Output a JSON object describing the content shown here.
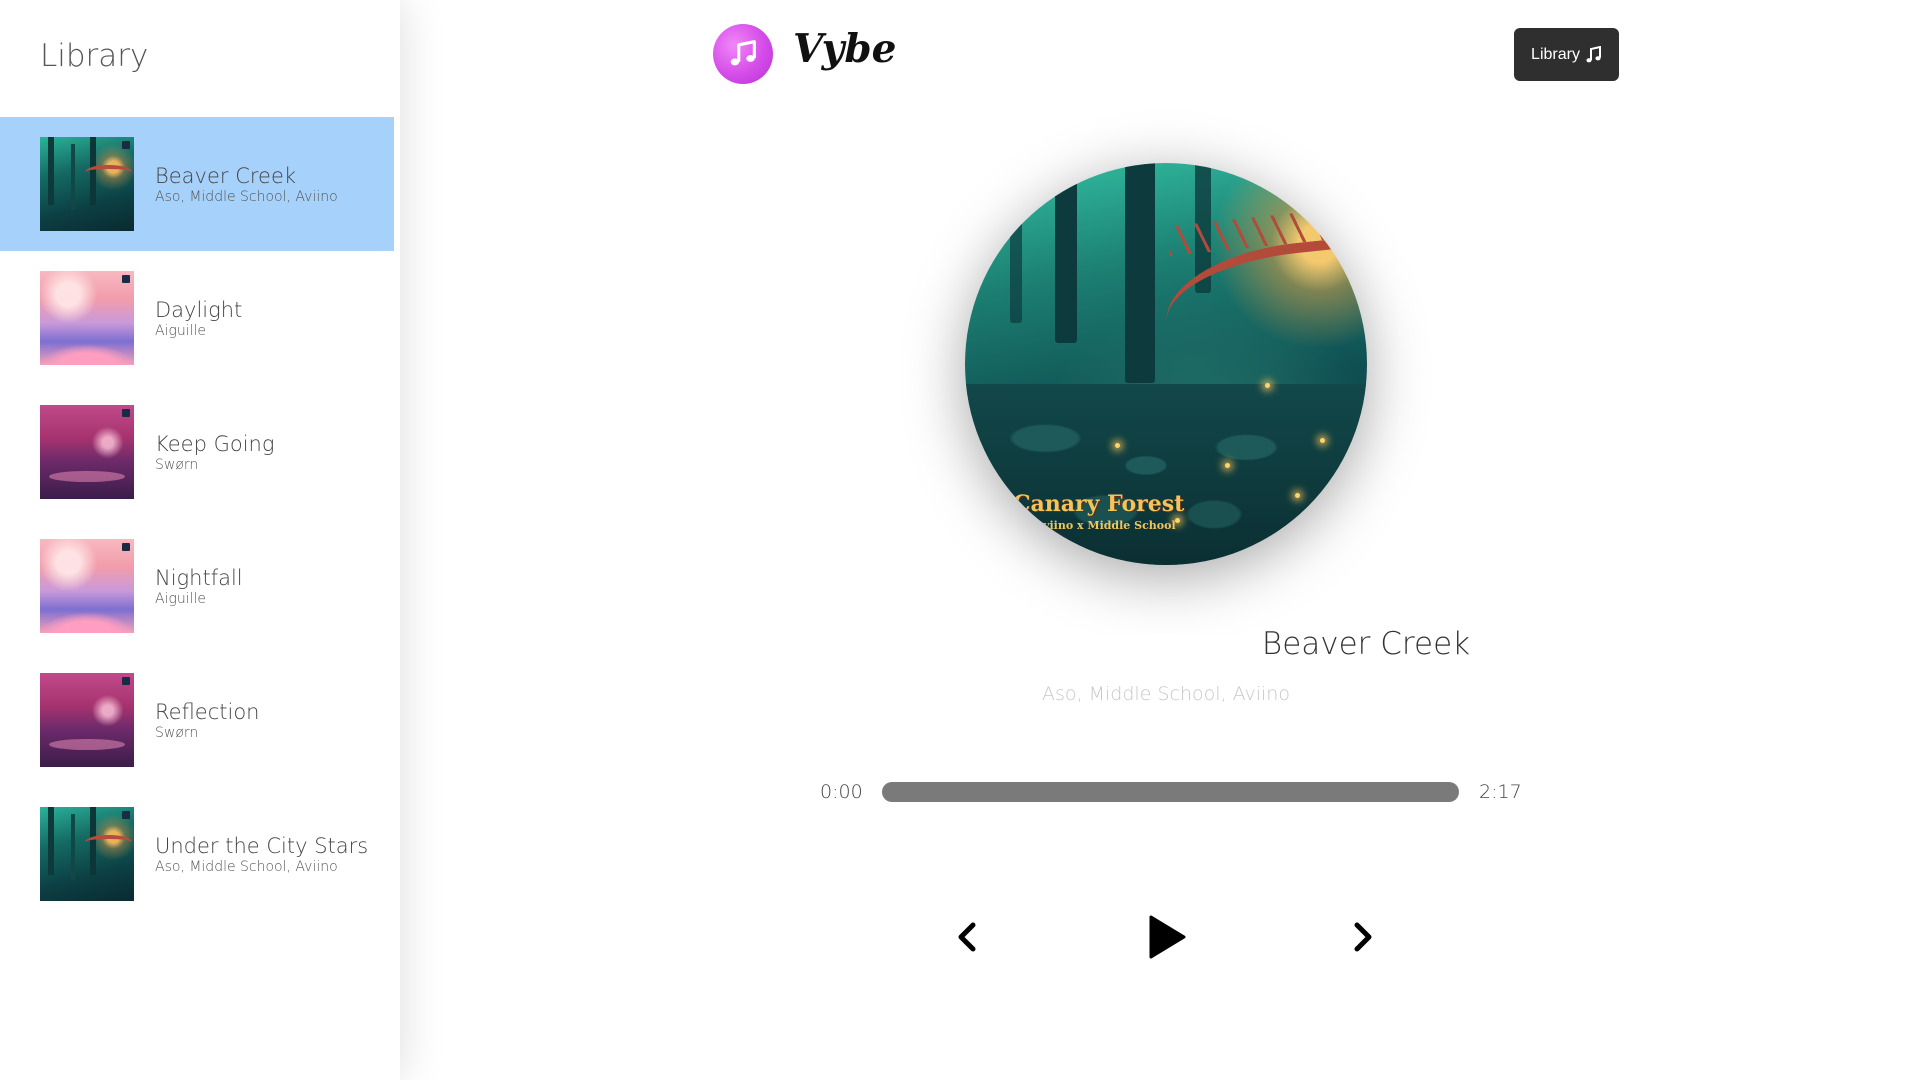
{
  "app": {
    "name": "Vybe",
    "library_button_label": "Library",
    "accent_color": "#a6d1fb",
    "logo_color": "#d44ce8"
  },
  "sidebar": {
    "title": "Library",
    "songs": [
      {
        "name": "Beaver Creek",
        "artist": "Aso, Middle School, Aviino",
        "cover": "forest",
        "active": true
      },
      {
        "name": "Daylight",
        "artist": "Aiguille",
        "cover": "pink",
        "active": false
      },
      {
        "name": "Keep Going",
        "artist": "Swørn",
        "cover": "magenta",
        "active": false
      },
      {
        "name": "Nightfall",
        "artist": "Aiguille",
        "cover": "pink",
        "active": false
      },
      {
        "name": "Reflection",
        "artist": "Swørn",
        "cover": "magenta",
        "active": false
      },
      {
        "name": "Under the City Stars",
        "artist": "Aso, Middle School, Aviino",
        "cover": "forest",
        "active": false
      }
    ]
  },
  "player": {
    "album_art_text": "Canary Forest",
    "album_art_subtext": "Aviino x Middle School",
    "title": "Beaver Creek",
    "artist": "Aso, Middle School, Aviino",
    "time_current": "0:00",
    "time_total": "2:17",
    "progress_fraction": 0.0,
    "controls": {
      "prev_icon": "chevron-left-icon",
      "play_icon": "play-icon",
      "next_icon": "chevron-right-icon"
    }
  }
}
